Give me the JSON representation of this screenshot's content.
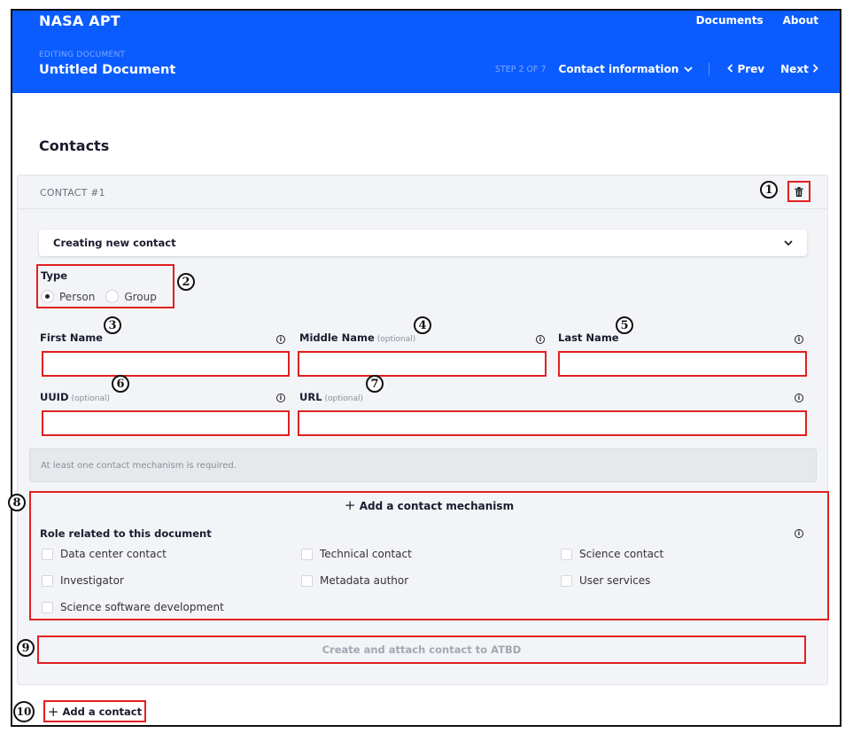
{
  "header": {
    "brand": "NASA APT",
    "nav": [
      "Documents",
      "About"
    ],
    "editing_label": "EDITING DOCUMENT",
    "doc_title": "Untitled Document",
    "step_count": "STEP 2 OF 7",
    "step_name": "Contact information",
    "prev": "Prev",
    "next": "Next"
  },
  "page_title": "Contacts",
  "card": {
    "label": "CONTACT #1",
    "select_value": "Creating new contact",
    "type_label": "Type",
    "type_options": [
      "Person",
      "Group"
    ],
    "type_selected": "Person",
    "fields": {
      "first_name": {
        "label": "First Name",
        "optional": ""
      },
      "middle_name": {
        "label": "Middle Name",
        "optional": "(optional)"
      },
      "last_name": {
        "label": "Last Name",
        "optional": ""
      },
      "uuid": {
        "label": "UUID",
        "optional": "(optional)"
      },
      "url": {
        "label": "URL",
        "optional": "(optional)"
      }
    },
    "notice": "At least one contact mechanism is required.",
    "add_mechanism": "Add a contact mechanism",
    "role_title": "Role related to this document",
    "roles": [
      "Data center contact",
      "Technical contact",
      "Science contact",
      "Investigator",
      "Metadata author",
      "User services",
      "Science software development"
    ],
    "create_button": "Create and attach contact to ATBD"
  },
  "add_contact": "Add a contact",
  "callouts": [
    "1",
    "2",
    "3",
    "4",
    "5",
    "6",
    "7",
    "8",
    "9",
    "10"
  ],
  "colors": {
    "header_blue": "#0b5cff",
    "annotation_red": "#e02020"
  }
}
